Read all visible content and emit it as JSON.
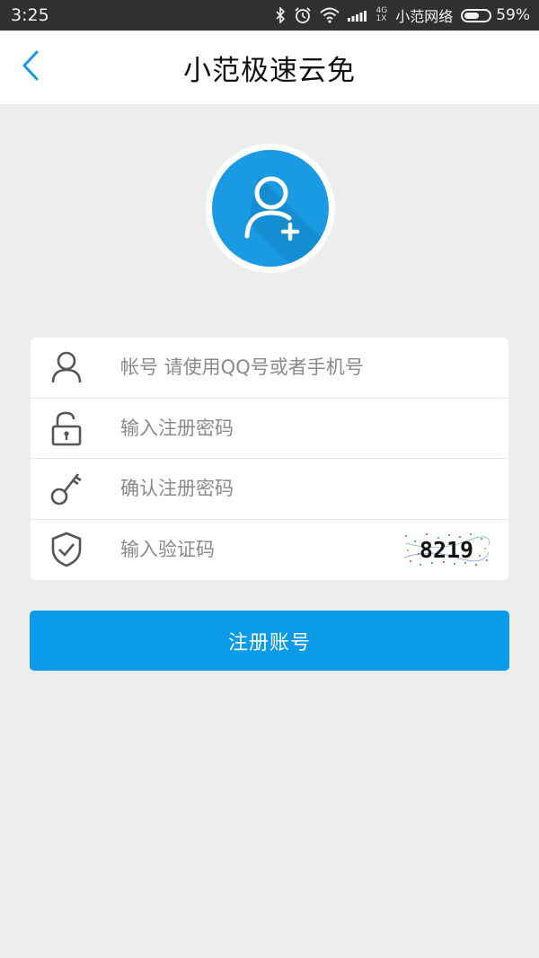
{
  "status_bar": {
    "time": "3:25",
    "net_type_top": "4G",
    "net_type_bottom": "1X",
    "carrier": "小范网络",
    "battery_percent": "59%",
    "battery_level": 0.59,
    "icons": [
      "bluetooth-icon",
      "alarm-icon",
      "wifi-icon",
      "signal-icon",
      "battery-icon"
    ]
  },
  "header": {
    "title": "小范极速云免",
    "back_icon": "chevron-left-icon"
  },
  "avatar": {
    "icon": "add-user-icon",
    "color": "#1a9ae3"
  },
  "form": {
    "account": {
      "placeholder": "帐号 请使用QQ号或者手机号",
      "value": "",
      "icon": "user-icon"
    },
    "password": {
      "placeholder": "输入注册密码",
      "value": "",
      "icon": "unlock-icon"
    },
    "confirm_password": {
      "placeholder": "确认注册密码",
      "value": "",
      "icon": "key-icon"
    },
    "captcha": {
      "placeholder": "输入验证码",
      "value": "",
      "icon": "shield-check-icon",
      "code": "8219"
    }
  },
  "submit_label": "注册账号",
  "colors": {
    "accent": "#0b9bea",
    "background": "#ededed",
    "status_bar": "#303030"
  }
}
